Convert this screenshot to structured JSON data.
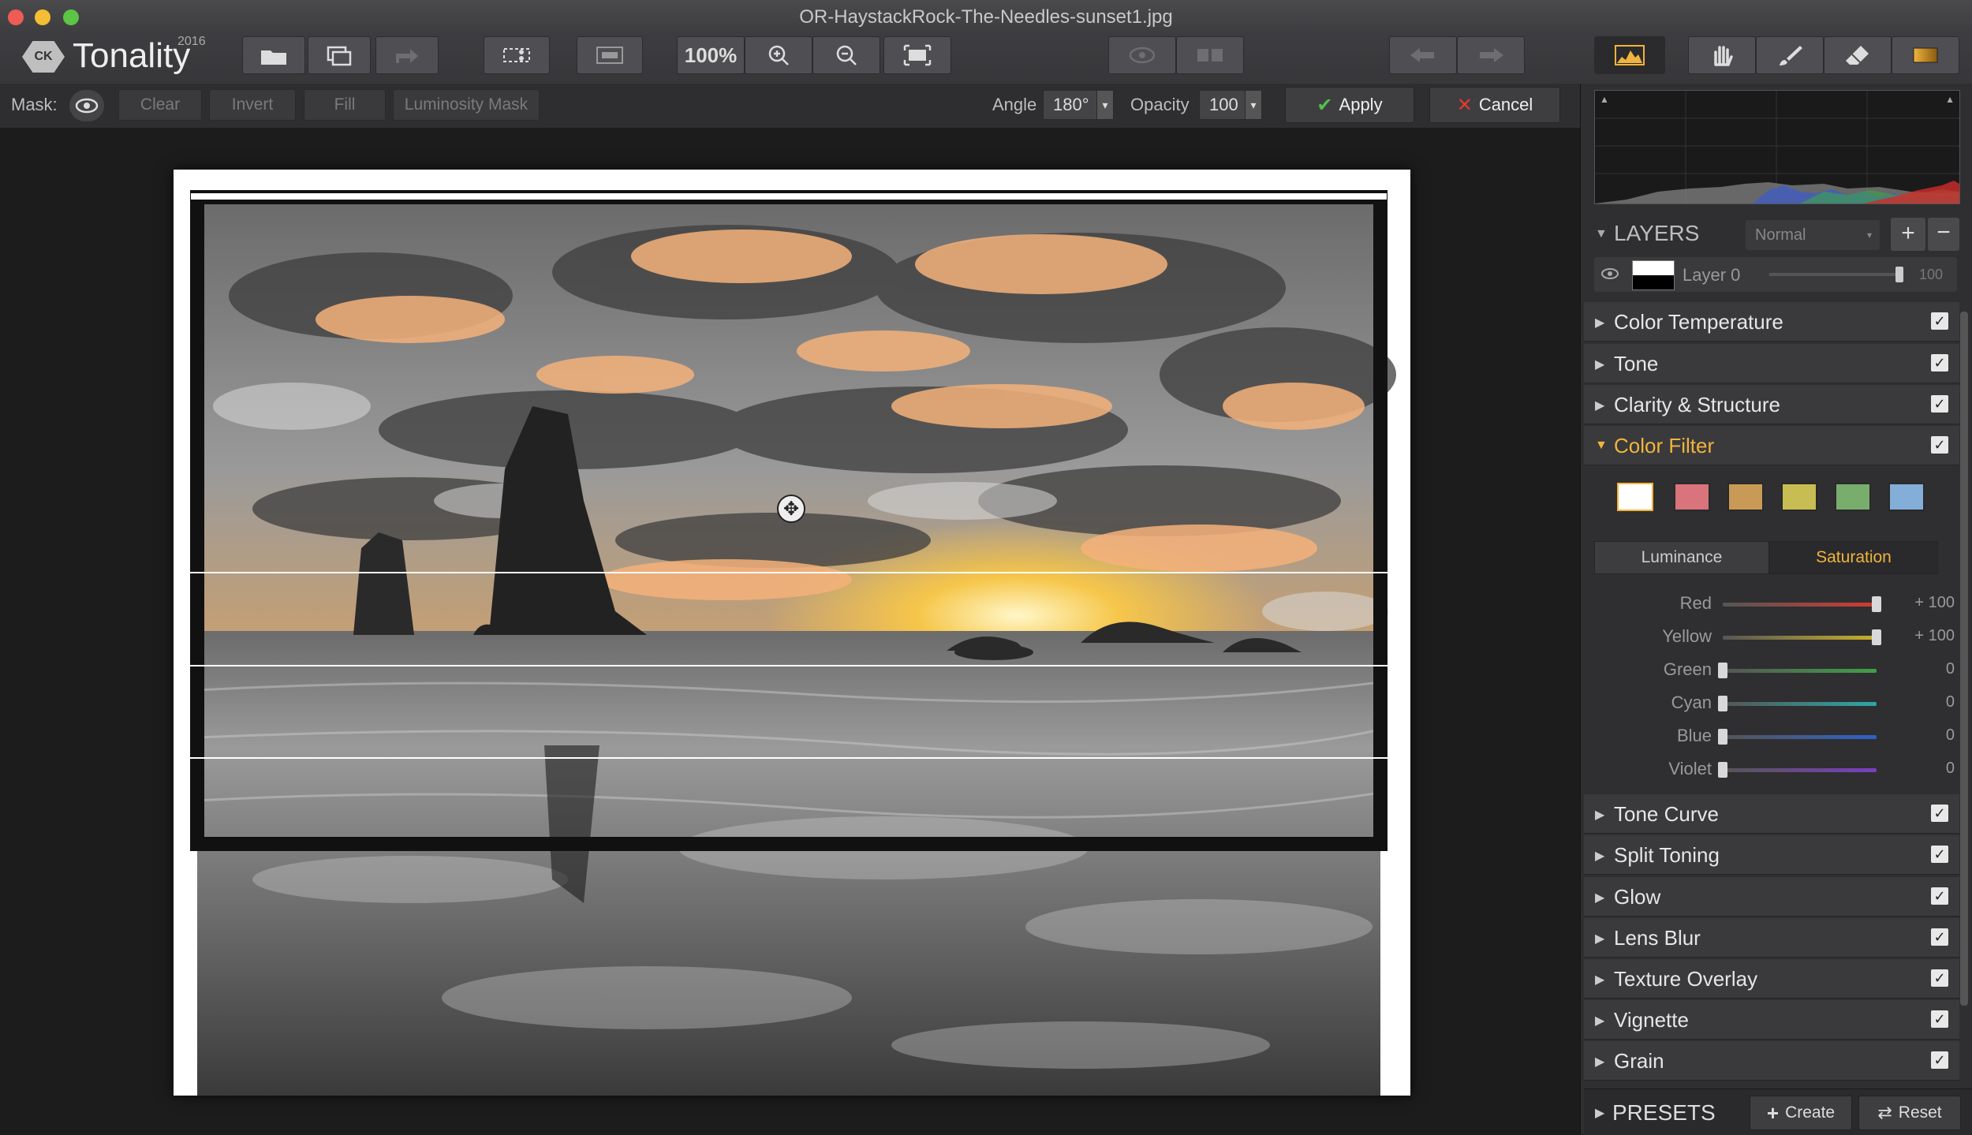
{
  "window": {
    "title": "OR-HaystackRock-The-Needles-sunset1.jpg"
  },
  "app": {
    "name": "Tonality",
    "year": "2016",
    "logo_text": "CK"
  },
  "toolbar": {
    "zoom_label": "100%",
    "icons": [
      "open-icon",
      "batch-icon",
      "export-icon",
      "crop-icon",
      "compare-icon",
      "zoom-in-icon",
      "zoom-out-icon",
      "fit-icon",
      "preview-icon",
      "split-view-icon",
      "undo-icon",
      "redo-icon",
      "histogram-icon",
      "hand-icon",
      "brush-icon",
      "eraser-icon",
      "gradient-icon"
    ]
  },
  "mask": {
    "label": "Mask:",
    "clear": "Clear",
    "invert": "Invert",
    "fill": "Fill",
    "luminosity": "Luminosity Mask",
    "angle_label": "Angle",
    "angle_value": "180°",
    "opacity_label": "Opacity",
    "opacity_value": "100",
    "apply": "Apply",
    "cancel": "Cancel"
  },
  "layers": {
    "title": "LAYERS",
    "blend_mode": "Normal",
    "layer_name": "Layer 0",
    "layer_opacity": "100",
    "layer_opacity_fraction": 1.0
  },
  "sections_top": [
    {
      "label": "Color Temperature",
      "checked": true
    },
    {
      "label": "Tone",
      "checked": true
    },
    {
      "label": "Clarity & Structure",
      "checked": true
    }
  ],
  "color_filter": {
    "label": "Color Filter",
    "checked": true,
    "swatches": [
      "#ffffff",
      "#d9737c",
      "#c99a55",
      "#c8bd52",
      "#79ad6e",
      "#82aed8"
    ],
    "tabs": [
      "Luminance",
      "Saturation"
    ],
    "active_tab": "Saturation",
    "sliders": [
      {
        "label": "Red",
        "value": "+ 100",
        "fraction": 1.0,
        "color": "#d23a30"
      },
      {
        "label": "Yellow",
        "value": "+ 100",
        "fraction": 1.0,
        "color": "#c9b02a"
      },
      {
        "label": "Green",
        "value": "0",
        "fraction": 0.0,
        "color": "#3fa046"
      },
      {
        "label": "Cyan",
        "value": "0",
        "fraction": 0.0,
        "color": "#2aa8a8"
      },
      {
        "label": "Blue",
        "value": "0",
        "fraction": 0.0,
        "color": "#2f5fc8"
      },
      {
        "label": "Violet",
        "value": "0",
        "fraction": 0.0,
        "color": "#7a3ec0"
      }
    ]
  },
  "sections_bottom": [
    {
      "label": "Tone Curve",
      "checked": true
    },
    {
      "label": "Split Toning",
      "checked": true
    },
    {
      "label": "Glow",
      "checked": true
    },
    {
      "label": "Lens Blur",
      "checked": true
    },
    {
      "label": "Texture Overlay",
      "checked": true
    },
    {
      "label": "Vignette",
      "checked": true
    },
    {
      "label": "Grain",
      "checked": true
    }
  ],
  "presets": {
    "title": "PRESETS",
    "create": "Create",
    "reset": "Reset"
  },
  "colors": {
    "accent": "#f0b43c",
    "panel_bg": "#2f2f31",
    "canvas_bg": "#1c1c1d"
  }
}
